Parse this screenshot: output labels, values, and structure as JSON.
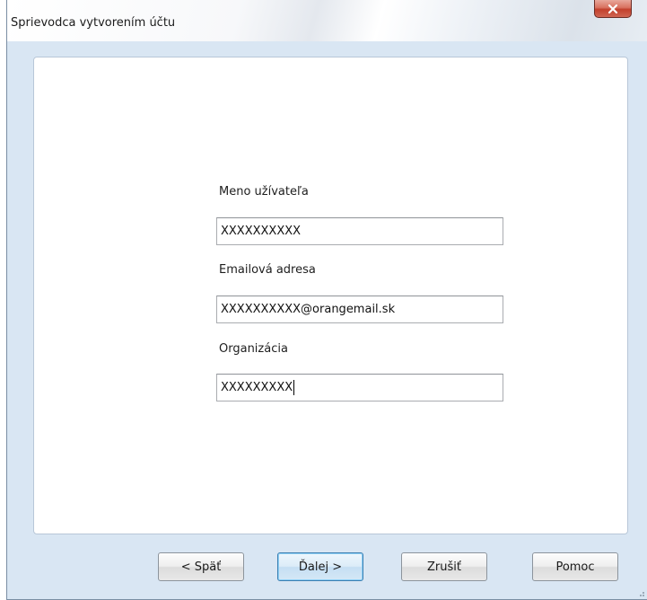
{
  "window": {
    "title": "Sprievodca vytvorením účtu"
  },
  "form": {
    "username": {
      "label": "Meno užívateľa",
      "value": "XXXXXXXXXX"
    },
    "email": {
      "label": "Emailová adresa",
      "value": "XXXXXXXXXX@orangemail.sk"
    },
    "organization": {
      "label": "Organizácia",
      "value": "XXXXXXXXX"
    }
  },
  "buttons": {
    "back": "< Späť",
    "next": "Ďalej >",
    "cancel": "Zrušiť",
    "help": "Pomoc"
  },
  "icons": {
    "close": "close-icon"
  },
  "colors": {
    "dialog_background": "#d9e6f3",
    "close_button": "#c2402c",
    "default_button_border": "#3c7fb1"
  }
}
